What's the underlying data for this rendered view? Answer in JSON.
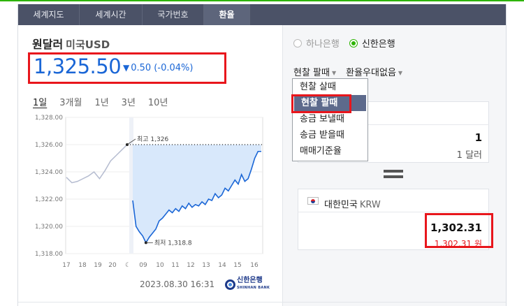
{
  "tabs": [
    {
      "label": "세계지도"
    },
    {
      "label": "세계시간"
    },
    {
      "label": "국가번호"
    },
    {
      "label": "환율"
    }
  ],
  "currency": {
    "title": "원달러",
    "subtitle": "미국USD",
    "rate": "1,325.50",
    "change_arrow": "▼",
    "change": "0.50 (-0.04%)"
  },
  "periods": [
    "1일",
    "3개월",
    "1년",
    "3년",
    "10년"
  ],
  "chart_data": {
    "type": "line",
    "x_tick_labels": [
      "17",
      "18",
      "19",
      "20",
      "☾",
      "09",
      "10",
      "11",
      "12",
      "13",
      "14",
      "15",
      "16"
    ],
    "y_tick_labels": [
      "1,328.00",
      "1,326.00",
      "1,324.00",
      "1,322.00",
      "1,320.00",
      "1,318.00"
    ],
    "ylim": [
      1318,
      1328
    ],
    "previous_session": [
      1323.6,
      1323.2,
      1323.3,
      1323.5,
      1323.7,
      1324.0,
      1323.5,
      1324.1,
      1324.8,
      1325.2,
      1325.6,
      1326.0
    ],
    "today": [
      1321.9,
      1320.0,
      1319.6,
      1319.3,
      1318.8,
      1319.2,
      1319.5,
      1319.8,
      1320.4,
      1320.6,
      1320.9,
      1321.2,
      1321.0,
      1321.3,
      1321.1,
      1321.5,
      1321.3,
      1321.7,
      1321.4,
      1321.6,
      1321.5,
      1321.8,
      1321.6,
      1322.0,
      1321.9,
      1322.4,
      1322.1,
      1322.3,
      1322.8,
      1322.6,
      1323.0,
      1323.4,
      1323.1,
      1323.8,
      1323.3,
      1323.5,
      1324.2,
      1325.0,
      1325.5,
      1325.5
    ],
    "reference_line": 1326,
    "high_label": "최고 1,326",
    "low_label": "최저 1,318.8"
  },
  "timestamp": "2023.08.30 16:31",
  "bank_logo": {
    "name": "신한은행",
    "en": "SHINHAN BANK"
  },
  "banks": [
    {
      "label": "하나은행",
      "selected": false
    },
    {
      "label": "신한은행",
      "selected": true
    }
  ],
  "selects": {
    "type": "현찰 팔때",
    "discount": "환율우대없음"
  },
  "dropdown_options": [
    "현찰 살때",
    "현찰 팔때",
    "송금 보낼때",
    "송금 받을때",
    "매매기준율"
  ],
  "dropdown_selected_index": 1,
  "from": {
    "amount": "1",
    "unit": "1 달러"
  },
  "to": {
    "country": "대한민국",
    "code": "KRW",
    "amount": "1,302.31",
    "unit": "1,302.31 원"
  },
  "colors": {
    "accent_green": "#2db400",
    "rate_blue": "#1a66d6",
    "highlight_red": "#e8161c",
    "tab_bg": "#4b5267"
  }
}
